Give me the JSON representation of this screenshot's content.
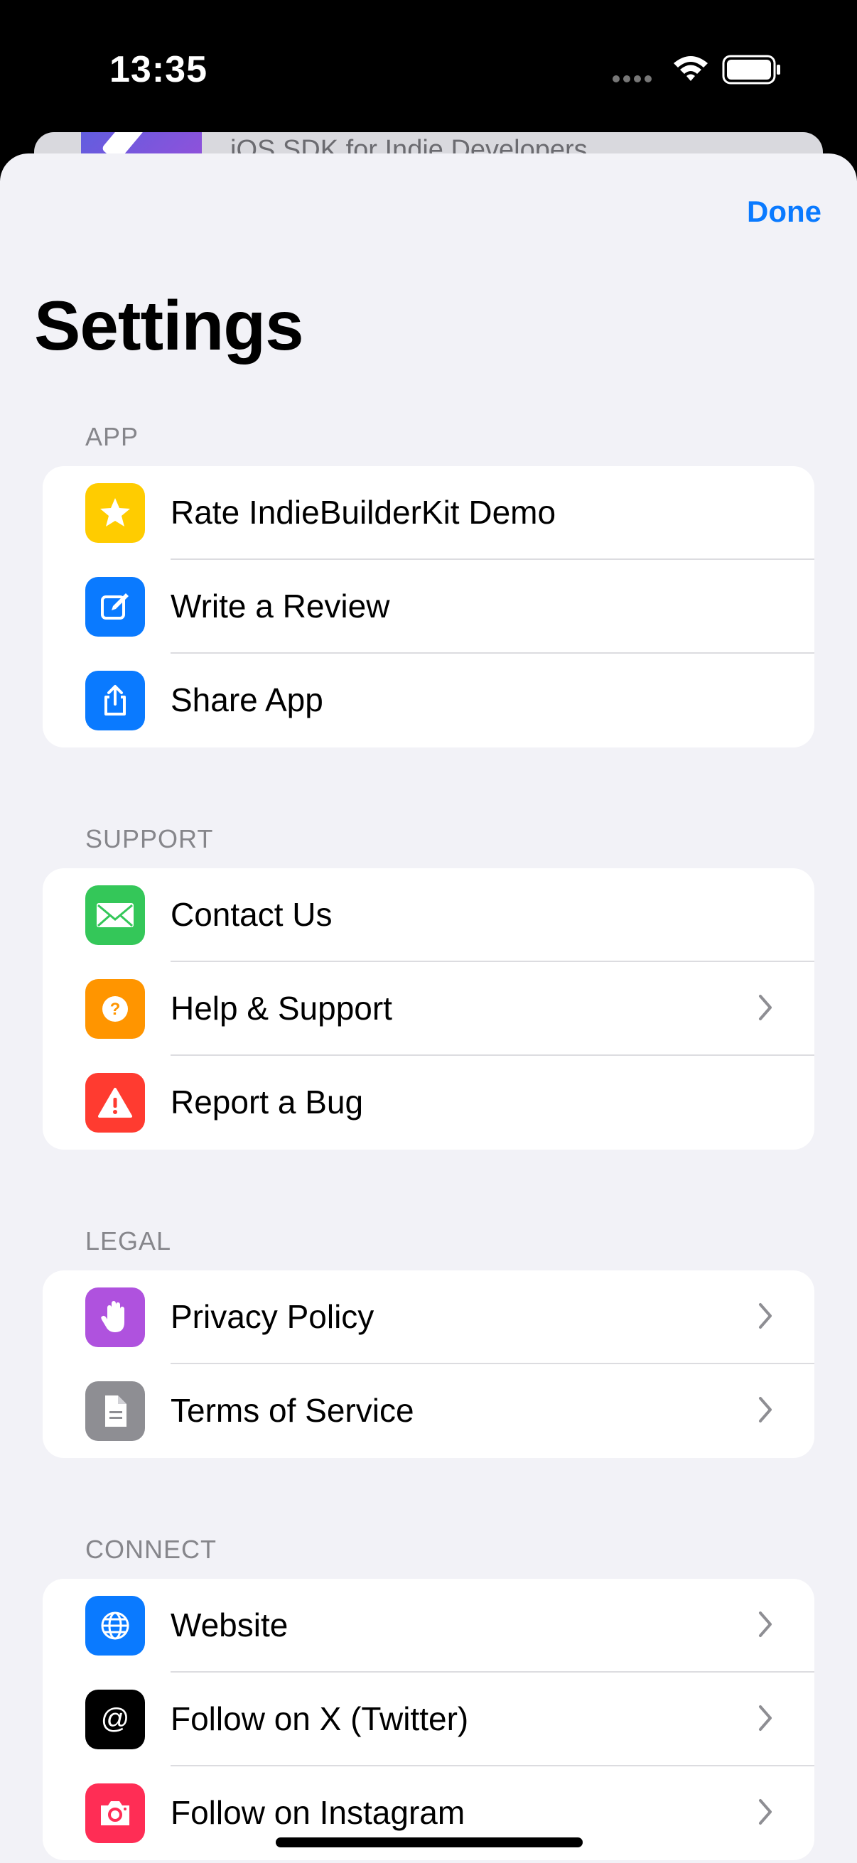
{
  "status_bar": {
    "time": "13:35"
  },
  "background_card": {
    "subtitle": "iOS SDK for Indie Developers"
  },
  "header": {
    "done_label": "Done",
    "title": "Settings"
  },
  "sections": [
    {
      "header": "APP",
      "items": [
        {
          "label": "Rate IndieBuilderKit Demo",
          "icon": "star-icon",
          "color": "#ffcc00",
          "chevron": false
        },
        {
          "label": "Write a Review",
          "icon": "compose-icon",
          "color": "#0a7aff",
          "chevron": false
        },
        {
          "label": "Share App",
          "icon": "share-icon",
          "color": "#0a7aff",
          "chevron": false
        }
      ]
    },
    {
      "header": "SUPPORT",
      "items": [
        {
          "label": "Contact Us",
          "icon": "envelope-icon",
          "color": "#34c759",
          "chevron": false
        },
        {
          "label": "Help & Support",
          "icon": "question-icon",
          "color": "#ff9500",
          "chevron": true
        },
        {
          "label": "Report a Bug",
          "icon": "warning-icon",
          "color": "#ff3b30",
          "chevron": false
        }
      ]
    },
    {
      "header": "LEGAL",
      "items": [
        {
          "label": "Privacy Policy",
          "icon": "hand-icon",
          "color": "#af52de",
          "chevron": true
        },
        {
          "label": "Terms of Service",
          "icon": "document-icon",
          "color": "#8e8e93",
          "chevron": true
        }
      ]
    },
    {
      "header": "CONNECT",
      "items": [
        {
          "label": "Website",
          "icon": "globe-icon",
          "color": "#0a7aff",
          "chevron": true
        },
        {
          "label": "Follow on X (Twitter)",
          "icon": "at-icon",
          "color": "#000000",
          "chevron": true
        },
        {
          "label": "Follow on Instagram",
          "icon": "camera-icon",
          "color": "#ff2d55",
          "chevron": true
        }
      ]
    }
  ]
}
